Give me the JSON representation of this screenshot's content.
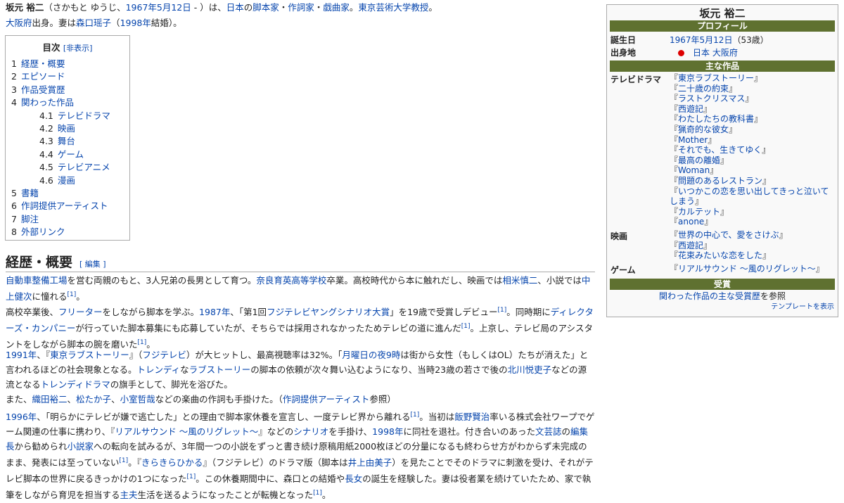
{
  "intro": {
    "name": "坂元 裕二",
    "reading_open": "（さかもと ゆうじ、",
    "birth_link": "1967年5月12日",
    "reading_close": " - ）は、",
    "country": "日本",
    "no": "の",
    "roles": [
      "脚本家",
      "作詞家",
      "戯曲家"
    ],
    "sep": "・",
    "dot1": "。",
    "university": "東京芸術大学教授",
    "dot2": "。",
    "pref": "大阪府",
    "born": "出身。妻は",
    "wife": "森口瑶子",
    "year_open": "（",
    "marriage_year": "1998年",
    "year_close": "結婚）。"
  },
  "toc": {
    "title": "目次",
    "toggle": "[非表示]",
    "items": [
      {
        "num": "1",
        "label": "経歴・概要"
      },
      {
        "num": "2",
        "label": "エピソード"
      },
      {
        "num": "3",
        "label": "作品受賞歴"
      },
      {
        "num": "4",
        "label": "関わった作品"
      },
      {
        "num": "4.1",
        "label": "テレビドラマ"
      },
      {
        "num": "4.2",
        "label": "映画"
      },
      {
        "num": "4.3",
        "label": "舞台"
      },
      {
        "num": "4.4",
        "label": "ゲーム"
      },
      {
        "num": "4.5",
        "label": "テレビアニメ"
      },
      {
        "num": "4.6",
        "label": "漫画"
      },
      {
        "num": "5",
        "label": "書籍"
      },
      {
        "num": "6",
        "label": "作詞提供アーティスト"
      },
      {
        "num": "7",
        "label": "脚注"
      },
      {
        "num": "8",
        "label": "外部リンク"
      }
    ]
  },
  "section": {
    "title": "経歴・概要",
    "edit": "[ 編集 ]"
  },
  "p1": {
    "a": "自動車整備工場",
    "b": "を営む両親のもと、3人兄弟の長男として育つ。",
    "c": "奈良育英高等学校",
    "d": "卒業。高校時代から本に触れだし、映画では",
    "e": "相米慎二",
    "f": "、小説では",
    "g": "中上健次",
    "h": "に憧れる",
    "ref": "[1]",
    "i": "。"
  },
  "p2": {
    "a": "高校卒業後、",
    "b": "フリーター",
    "c": "をしながら脚本を学ぶ。",
    "d": "1987年",
    "e": "、「第1回",
    "f": "フジテレビヤングシナリオ大賞",
    "g": "」を19歳で受賞しデビュー",
    "ref1": "[1]",
    "h": "。同時期に",
    "i": "ディレクターズ・カンパニー",
    "j": "が行っていた脚本募集にも応募していたが、そちらでは採用されなかったためテレビの道に進んだ",
    "ref2": "[1]",
    "k": "。上京し、テレビ局のアシスタントをしながら脚本の腕を磨いた",
    "ref3": "[1]",
    "l": "。"
  },
  "p3": {
    "a": "1991年",
    "b": "、『",
    "c": "東京ラブストーリー",
    "d": "』（",
    "e": "フジテレビ",
    "f": "）が大ヒットし、最高視聴率は32%。「",
    "g": "月曜日の夜9時",
    "h": "は街から女性（もしくはOL）たちが消えた」と言われるほどの社会現象となる。",
    "i": "トレンディ",
    "j": "な",
    "k": "ラブストーリー",
    "l": "の脚本の依頼が次々舞い込むようになり、当時23歳の若さで後の",
    "m": "北川悦吏子",
    "n": "などの源流となる",
    "o": "トレンディドラマ",
    "p": "の旗手として、脚光を浴びた。"
  },
  "p4": {
    "a": "また、",
    "b": "織田裕二",
    "c": "、",
    "d": "松たか子",
    "e": "、",
    "f": "小室哲哉",
    "g": "などの楽曲の作詞も手掛けた。（",
    "h": "作詞提供アーティスト",
    "i": "参照）"
  },
  "p5": {
    "a": "1996年",
    "b": "、「明らかにテレビが嫌で逃亡した」との理由で脚本家休養を宣言し、一度テレビ界から離れる",
    "ref1": "[1]",
    "c": "。当初は",
    "d": "飯野賢治",
    "e": "率いる株式会社ワープでゲーム関連の仕事に携わり、『",
    "f": "リアルサウンド 〜風のリグレット〜",
    "g": "』などの",
    "h": "シナリオ",
    "i": "を手掛け、",
    "j": "1998年",
    "k": "に同社を退社。付き合いのあった",
    "l": "文芸誌",
    "m": "の",
    "n": "編集長",
    "o": "から勧められ",
    "p": "小説家",
    "q": "への転向を試みるが、3年間一つの小説をずっと書き続け原稿用紙2000枚ほどの分量になるも終わらせ方がわからず未完成のまま、発表には至っていない",
    "ref2": "[1]",
    "r": "。『",
    "s": "きらきらひかる",
    "t": "』（フジテレビ）のドラマ版（脚本は",
    "u": "井上由美子",
    "v": "）を見たことでそのドラマに刺激を受け、それがテレビ脚本の世界に戻るきっかけの1つになった",
    "ref3": "[1]",
    "w": "。この休養期間中に、森口との結婚や",
    "x": "長女",
    "y": "の誕生を経験した。妻は役者業を続けていたため、家で執筆をしながら育児を担当する",
    "z": "主夫",
    "aa": "生活を送るようになったことが転機となった",
    "ref4": "[1]",
    "bb": "。"
  },
  "infobox": {
    "title": "坂元 裕二",
    "profile_header": "プロフィール",
    "birth_key": "誕生日",
    "birth_val": "1967年5月12日",
    "age": "（53歳）",
    "origin_key": "出身地",
    "origin_country": "日本",
    "origin_pref": "大阪府",
    "works_header": "主な作品",
    "tv_key": "テレビドラマ",
    "tv": [
      "東京ラブストーリー",
      "二十歳の約束",
      "ラストクリスマス",
      "西遊記",
      "わたしたちの教科書",
      "猟奇的な彼女",
      "Mother",
      "それでも、生きてゆく",
      "最高の離婚",
      "Woman",
      "問題のあるレストラン",
      "いつかこの恋を思い出してきっと泣いてしまう",
      "カルテット",
      "anone"
    ],
    "film_key": "映画",
    "films": [
      "世界の中心で、愛をさけぶ",
      "西遊記",
      "花束みたいな恋をした"
    ],
    "game_key": "ゲーム",
    "games": [
      "リアルサウンド 〜風のリグレット〜"
    ],
    "award_header": "受賞",
    "award_link": "関わった作品の主な受賞歴",
    "award_suffix": "を参照",
    "template_link": "テンプレートを表示",
    "open_q": "『",
    "close_q": "』"
  }
}
